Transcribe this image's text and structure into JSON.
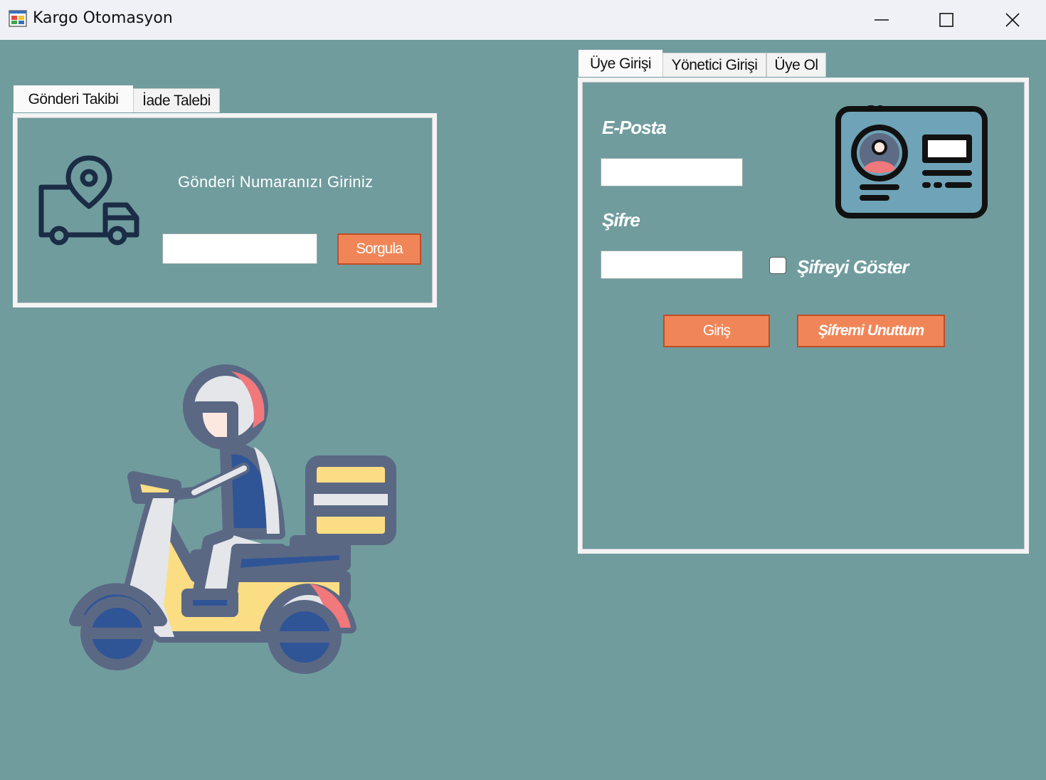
{
  "window": {
    "title": "Kargo Otomasyon",
    "icon": "app-window-icon"
  },
  "left_panel": {
    "tabs": [
      {
        "label": "Gönderi Takibi",
        "active": true
      },
      {
        "label": "İade Talebi",
        "active": false
      }
    ],
    "prompt": "Gönderi Numaranızı Giriniz",
    "tracking_input": {
      "value": "",
      "placeholder": ""
    },
    "query_button": "Sorgula",
    "icon": "delivery-truck-location-icon"
  },
  "illustration": {
    "icon": "scooter-courier-icon"
  },
  "right_panel": {
    "tabs": [
      {
        "label": "Üye Girişi",
        "active": true
      },
      {
        "label": "Yönetici Girişi",
        "active": false
      },
      {
        "label": "Üye Ol",
        "active": false
      }
    ],
    "email_label": "E-Posta",
    "email_input": {
      "value": ""
    },
    "password_label": "Şifre",
    "password_input": {
      "value": ""
    },
    "show_password": {
      "label": "Şifreyi Göster",
      "checked": false
    },
    "login_button": "Giriş",
    "forgot_button": "Şifremi Unuttum",
    "icon": "id-card-icon"
  },
  "colors": {
    "background": "#709c9e",
    "button": "#f08658",
    "button_border": "#c04d26",
    "titlebar": "#eff1f6"
  }
}
